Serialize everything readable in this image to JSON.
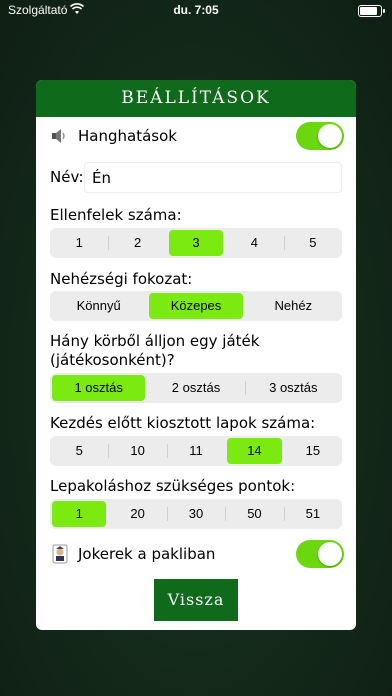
{
  "status": {
    "carrier": "Szolgáltató",
    "time": "du. 7:05"
  },
  "settings": {
    "title": "BEÁLLÍTÁSOK",
    "sound": {
      "label": "Hanghatások",
      "on": true
    },
    "name": {
      "label": "Név:",
      "value": "Én"
    },
    "opponents": {
      "label": "Ellenfelek száma:",
      "options": [
        "1",
        "2",
        "3",
        "4",
        "5"
      ],
      "selected": "3"
    },
    "difficulty": {
      "label": "Nehézségi fokozat:",
      "options": [
        "Könnyű",
        "Közepes",
        "Nehéz"
      ],
      "selected": "Közepes"
    },
    "rounds": {
      "label_line1": "Hány körből álljon egy játék",
      "label_line2": "(játékosonként)?",
      "options": [
        "1 osztás",
        "2 osztás",
        "3 osztás"
      ],
      "selected": "1 osztás"
    },
    "cards": {
      "label": "Kezdés előtt kiosztott lapok száma:",
      "options": [
        "5",
        "10",
        "11",
        "14",
        "15"
      ],
      "selected": "14"
    },
    "points": {
      "label": "Lepakoláshoz szükséges pontok:",
      "options": [
        "1",
        "20",
        "30",
        "50",
        "51"
      ],
      "selected": "1"
    },
    "jokers": {
      "label": "Jokerek a pakliban",
      "on": true
    },
    "back_label": "Vissza"
  }
}
